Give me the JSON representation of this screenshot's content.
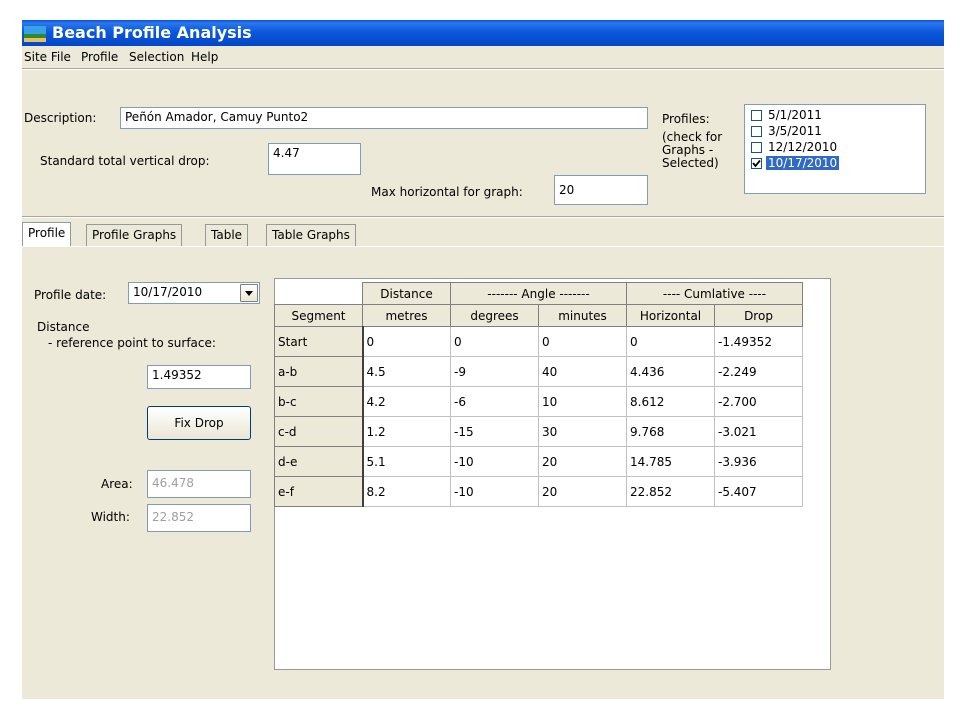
{
  "window": {
    "title": "Beach Profile Analysis"
  },
  "menu": {
    "items": [
      "Site File",
      "Profile",
      "Selection",
      "Help"
    ]
  },
  "header": {
    "description_label": "Description:",
    "description_value": "Peñón Amador, Camuy Punto2",
    "std_drop_label": "Standard total vertical drop:",
    "std_drop_value": "4.47",
    "max_horiz_label": "Max horizontal for graph:",
    "max_horiz_value": "20",
    "profiles_label": "Profiles:",
    "profiles_note": [
      "(check for",
      "Graphs -",
      "Selected)"
    ],
    "profiles": [
      {
        "date": "5/1/2011",
        "checked": false,
        "selected": false
      },
      {
        "date": "3/5/2011",
        "checked": false,
        "selected": false
      },
      {
        "date": "12/12/2010",
        "checked": false,
        "selected": false
      },
      {
        "date": "10/17/2010",
        "checked": true,
        "selected": true
      }
    ]
  },
  "tabs": [
    "Profile",
    "Profile Graphs",
    "Table",
    "Table Graphs"
  ],
  "profile_panel": {
    "date_label": "Profile date:",
    "date_value": "10/17/2010",
    "distance_label": "Distance",
    "distance_sub": "- reference point to surface:",
    "distance_value": "1.49352",
    "fix_drop_label": "Fix Drop",
    "area_label": "Area:",
    "area_value": "46.478",
    "width_label": "Width:",
    "width_value": "22.852"
  },
  "table": {
    "group_headers": [
      "Distance",
      "------- Angle -------",
      "---- Cumlative ----"
    ],
    "column_headers": [
      "Segment",
      "metres",
      "degrees",
      "minutes",
      "Horizontal",
      "Drop"
    ],
    "rows": [
      [
        "Start",
        "0",
        "0",
        "0",
        "0",
        "-1.49352"
      ],
      [
        "a-b",
        "4.5",
        "-9",
        "40",
        "4.436",
        "-2.249"
      ],
      [
        "b-c",
        "4.2",
        "-6",
        "10",
        "8.612",
        "-2.700"
      ],
      [
        "c-d",
        "1.2",
        "-15",
        "30",
        "9.768",
        "-3.021"
      ],
      [
        "d-e",
        "5.1",
        "-10",
        "20",
        "14.785",
        "-3.936"
      ],
      [
        "e-f",
        "8.2",
        "-10",
        "20",
        "22.852",
        "-5.407"
      ]
    ]
  }
}
